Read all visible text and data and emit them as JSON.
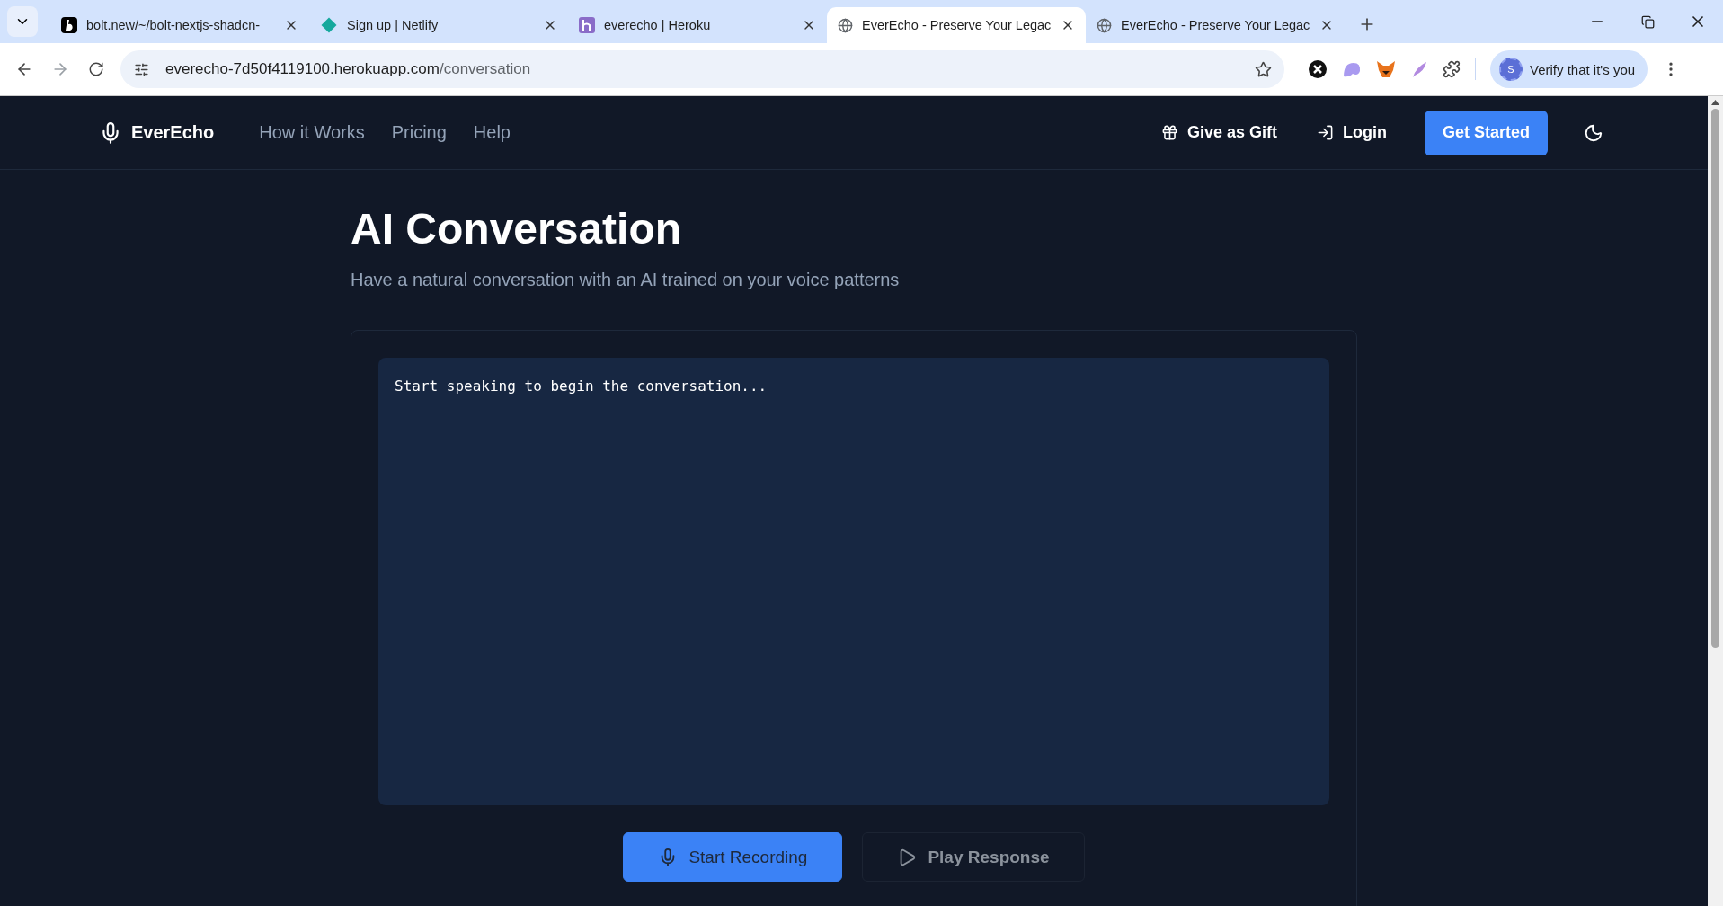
{
  "browser": {
    "tabs": [
      {
        "title": "bolt.new/~/bolt-nextjs-shadcn-",
        "selected": false
      },
      {
        "title": "Sign up | Netlify",
        "selected": false
      },
      {
        "title": "everecho | Heroku",
        "selected": false
      },
      {
        "title": "EverEcho - Preserve Your Legac",
        "selected": true
      },
      {
        "title": "EverEcho - Preserve Your Legac",
        "selected": false
      }
    ],
    "url_host": "everecho-7d50f4119100.herokuapp.com",
    "url_path": "/conversation",
    "profile": {
      "avatar_letter": "S",
      "label": "Verify that it's you"
    }
  },
  "nav": {
    "brand": "EverEcho",
    "links": [
      "How it Works",
      "Pricing",
      "Help"
    ],
    "gift": "Give as Gift",
    "login": "Login",
    "cta": "Get Started"
  },
  "page": {
    "title": "AI Conversation",
    "subtitle": "Have a natural conversation with an AI trained on your voice patterns",
    "transcript": "Start speaking to begin the conversation...",
    "buttons": [
      {
        "label": "Start Recording",
        "kind": "record",
        "disabled": false
      },
      {
        "label": "Play Response",
        "kind": "play",
        "disabled": true
      }
    ]
  }
}
